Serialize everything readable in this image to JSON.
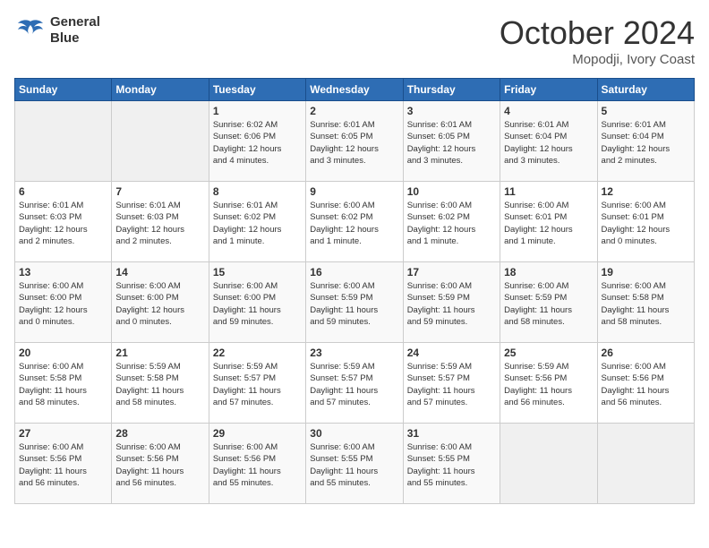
{
  "header": {
    "logo_line1": "General",
    "logo_line2": "Blue",
    "month": "October 2024",
    "location": "Mopodji, Ivory Coast"
  },
  "columns": [
    "Sunday",
    "Monday",
    "Tuesday",
    "Wednesday",
    "Thursday",
    "Friday",
    "Saturday"
  ],
  "weeks": [
    [
      {
        "day": "",
        "content": ""
      },
      {
        "day": "",
        "content": ""
      },
      {
        "day": "1",
        "content": "Sunrise: 6:02 AM\nSunset: 6:06 PM\nDaylight: 12 hours\nand 4 minutes."
      },
      {
        "day": "2",
        "content": "Sunrise: 6:01 AM\nSunset: 6:05 PM\nDaylight: 12 hours\nand 3 minutes."
      },
      {
        "day": "3",
        "content": "Sunrise: 6:01 AM\nSunset: 6:05 PM\nDaylight: 12 hours\nand 3 minutes."
      },
      {
        "day": "4",
        "content": "Sunrise: 6:01 AM\nSunset: 6:04 PM\nDaylight: 12 hours\nand 3 minutes."
      },
      {
        "day": "5",
        "content": "Sunrise: 6:01 AM\nSunset: 6:04 PM\nDaylight: 12 hours\nand 2 minutes."
      }
    ],
    [
      {
        "day": "6",
        "content": "Sunrise: 6:01 AM\nSunset: 6:03 PM\nDaylight: 12 hours\nand 2 minutes."
      },
      {
        "day": "7",
        "content": "Sunrise: 6:01 AM\nSunset: 6:03 PM\nDaylight: 12 hours\nand 2 minutes."
      },
      {
        "day": "8",
        "content": "Sunrise: 6:01 AM\nSunset: 6:02 PM\nDaylight: 12 hours\nand 1 minute."
      },
      {
        "day": "9",
        "content": "Sunrise: 6:00 AM\nSunset: 6:02 PM\nDaylight: 12 hours\nand 1 minute."
      },
      {
        "day": "10",
        "content": "Sunrise: 6:00 AM\nSunset: 6:02 PM\nDaylight: 12 hours\nand 1 minute."
      },
      {
        "day": "11",
        "content": "Sunrise: 6:00 AM\nSunset: 6:01 PM\nDaylight: 12 hours\nand 1 minute."
      },
      {
        "day": "12",
        "content": "Sunrise: 6:00 AM\nSunset: 6:01 PM\nDaylight: 12 hours\nand 0 minutes."
      }
    ],
    [
      {
        "day": "13",
        "content": "Sunrise: 6:00 AM\nSunset: 6:00 PM\nDaylight: 12 hours\nand 0 minutes."
      },
      {
        "day": "14",
        "content": "Sunrise: 6:00 AM\nSunset: 6:00 PM\nDaylight: 12 hours\nand 0 minutes."
      },
      {
        "day": "15",
        "content": "Sunrise: 6:00 AM\nSunset: 6:00 PM\nDaylight: 11 hours\nand 59 minutes."
      },
      {
        "day": "16",
        "content": "Sunrise: 6:00 AM\nSunset: 5:59 PM\nDaylight: 11 hours\nand 59 minutes."
      },
      {
        "day": "17",
        "content": "Sunrise: 6:00 AM\nSunset: 5:59 PM\nDaylight: 11 hours\nand 59 minutes."
      },
      {
        "day": "18",
        "content": "Sunrise: 6:00 AM\nSunset: 5:59 PM\nDaylight: 11 hours\nand 58 minutes."
      },
      {
        "day": "19",
        "content": "Sunrise: 6:00 AM\nSunset: 5:58 PM\nDaylight: 11 hours\nand 58 minutes."
      }
    ],
    [
      {
        "day": "20",
        "content": "Sunrise: 6:00 AM\nSunset: 5:58 PM\nDaylight: 11 hours\nand 58 minutes."
      },
      {
        "day": "21",
        "content": "Sunrise: 5:59 AM\nSunset: 5:58 PM\nDaylight: 11 hours\nand 58 minutes."
      },
      {
        "day": "22",
        "content": "Sunrise: 5:59 AM\nSunset: 5:57 PM\nDaylight: 11 hours\nand 57 minutes."
      },
      {
        "day": "23",
        "content": "Sunrise: 5:59 AM\nSunset: 5:57 PM\nDaylight: 11 hours\nand 57 minutes."
      },
      {
        "day": "24",
        "content": "Sunrise: 5:59 AM\nSunset: 5:57 PM\nDaylight: 11 hours\nand 57 minutes."
      },
      {
        "day": "25",
        "content": "Sunrise: 5:59 AM\nSunset: 5:56 PM\nDaylight: 11 hours\nand 56 minutes."
      },
      {
        "day": "26",
        "content": "Sunrise: 6:00 AM\nSunset: 5:56 PM\nDaylight: 11 hours\nand 56 minutes."
      }
    ],
    [
      {
        "day": "27",
        "content": "Sunrise: 6:00 AM\nSunset: 5:56 PM\nDaylight: 11 hours\nand 56 minutes."
      },
      {
        "day": "28",
        "content": "Sunrise: 6:00 AM\nSunset: 5:56 PM\nDaylight: 11 hours\nand 56 minutes."
      },
      {
        "day": "29",
        "content": "Sunrise: 6:00 AM\nSunset: 5:56 PM\nDaylight: 11 hours\nand 55 minutes."
      },
      {
        "day": "30",
        "content": "Sunrise: 6:00 AM\nSunset: 5:55 PM\nDaylight: 11 hours\nand 55 minutes."
      },
      {
        "day": "31",
        "content": "Sunrise: 6:00 AM\nSunset: 5:55 PM\nDaylight: 11 hours\nand 55 minutes."
      },
      {
        "day": "",
        "content": ""
      },
      {
        "day": "",
        "content": ""
      }
    ]
  ]
}
